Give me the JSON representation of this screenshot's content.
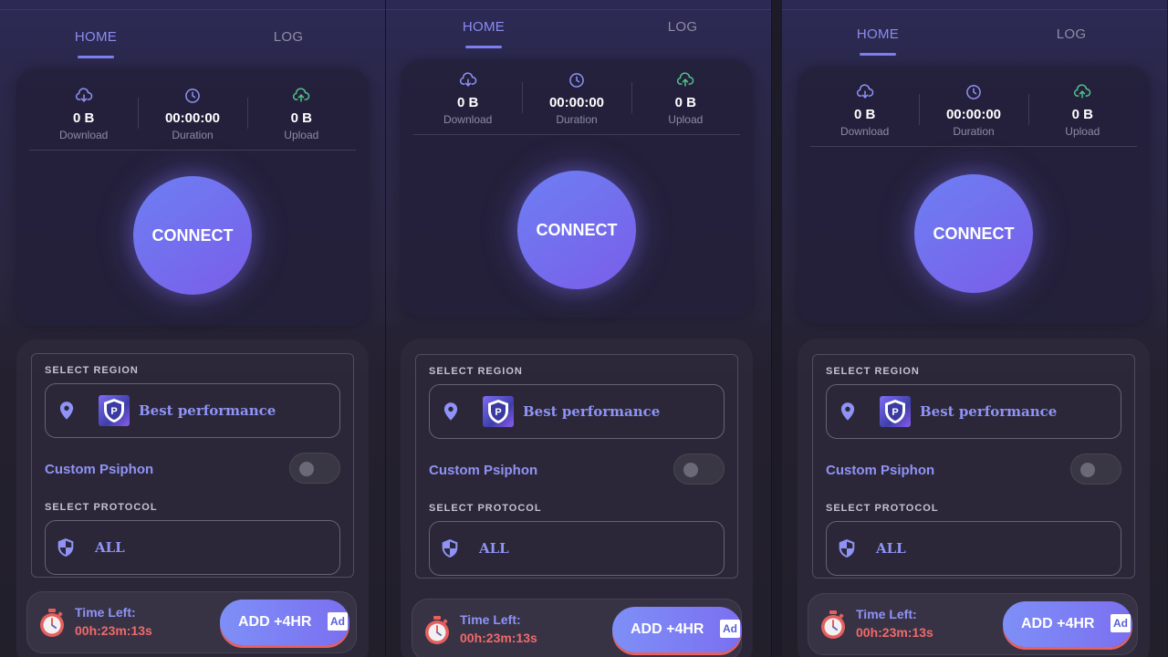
{
  "tabs": {
    "home": "HOME",
    "log": "LOG"
  },
  "stats": {
    "download": {
      "value": "0 B",
      "label": "Download",
      "icon": "cloud-download-icon"
    },
    "duration": {
      "value": "00:00:00",
      "label": "Duration",
      "icon": "clock-icon"
    },
    "upload": {
      "value": "0 B",
      "label": "Upload",
      "icon": "cloud-upload-icon"
    }
  },
  "connect_label": "CONNECT",
  "region": {
    "section_label": "SELECT REGION",
    "selected": "Best performance",
    "flag_letter": "P"
  },
  "custom_psiphon": {
    "label": "Custom Psiphon",
    "enabled": false
  },
  "protocol": {
    "section_label": "SELECT PROTOCOL",
    "selected": "ALL"
  },
  "timer": {
    "label": "Time Left:",
    "value": "00h:23m:13s",
    "add_label": "ADD +4HR",
    "ad_badge": "Ad"
  },
  "colors": {
    "accent": "#7c7ef2",
    "connect_gradient_start": "#6d7ff3",
    "connect_gradient_end": "#7a5ee9",
    "time_value": "#f06a6a",
    "upload_icon": "#4cc38a"
  }
}
